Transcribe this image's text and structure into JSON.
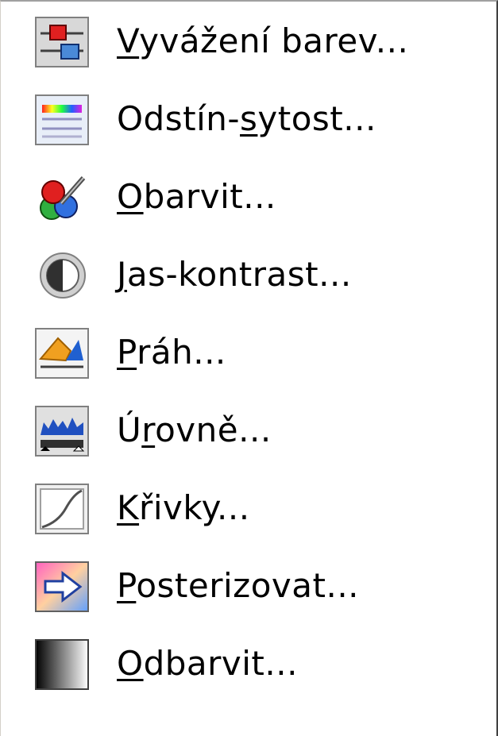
{
  "menu": {
    "items": [
      {
        "icon": "color-balance-icon",
        "label_underlined": "V",
        "label_rest": "yvážení barev..."
      },
      {
        "icon": "hue-saturation-icon",
        "label_pre": "Odstín-",
        "label_underlined": "s",
        "label_rest": "ytost..."
      },
      {
        "icon": "colorize-icon",
        "label_underlined": "O",
        "label_rest": "barvit..."
      },
      {
        "icon": "brightness-contrast-icon",
        "label_underlined": "J",
        "label_rest": "as-kontrast..."
      },
      {
        "icon": "threshold-icon",
        "label_underlined": "P",
        "label_rest": "ráh..."
      },
      {
        "icon": "levels-icon",
        "label_pre": "Ú",
        "label_underlined": "r",
        "label_rest": "ovně..."
      },
      {
        "icon": "curves-icon",
        "label_underlined": "K",
        "label_rest": "řivky..."
      },
      {
        "icon": "posterize-icon",
        "label_underlined": "P",
        "label_rest": "osterizovat..."
      },
      {
        "icon": "desaturate-icon",
        "label_underlined": "O",
        "label_rest": "dbarvit..."
      }
    ]
  }
}
